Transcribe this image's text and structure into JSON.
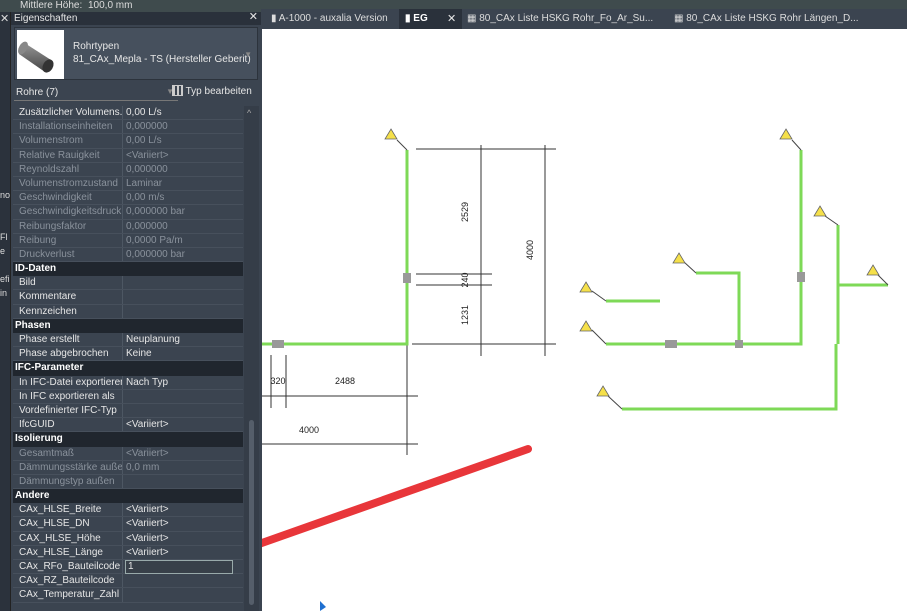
{
  "topbar": {
    "label": "Mittlere Höhe:",
    "value": "100,0 mm"
  },
  "leftstrip": [
    "no",
    "Fl",
    "e",
    "efi",
    "in"
  ],
  "panel": {
    "title": "Eigenschaften",
    "type_category": "Rohrtypen",
    "type_name": "81_CAx_Mepla - TS (Hersteller Geberit)",
    "filter": "Rohre (7)",
    "edit_type": "Typ bearbeiten"
  },
  "props": [
    {
      "k": "Zusätzlicher Volumens...",
      "v": "0,00 L/s"
    },
    {
      "k": "Installationseinheiten",
      "v": "0,000000",
      "dis": 1
    },
    {
      "k": "Volumenstrom",
      "v": "0,00 L/s",
      "dis": 1
    },
    {
      "k": "Relative Rauigkeit",
      "v": "<Variiert>",
      "dis": 1
    },
    {
      "k": "Reynoldszahl",
      "v": "0,000000",
      "dis": 1
    },
    {
      "k": "Volumenstromzustand",
      "v": "Laminar",
      "dis": 1
    },
    {
      "k": "Geschwindigkeit",
      "v": "0,00 m/s",
      "dis": 1
    },
    {
      "k": "Geschwindigkeitsdruck",
      "v": "0,000000 bar",
      "dis": 1
    },
    {
      "k": "Reibungsfaktor",
      "v": "0,000000",
      "dis": 1
    },
    {
      "k": "Reibung",
      "v": "0,0000 Pa/m",
      "dis": 1
    },
    {
      "k": "Druckverlust",
      "v": "0,000000 bar",
      "dis": 1
    },
    {
      "section": "ID-Daten"
    },
    {
      "k": "Bild",
      "v": ""
    },
    {
      "k": "Kommentare",
      "v": "",
      "cb": 1
    },
    {
      "k": "Kennzeichen",
      "v": ""
    },
    {
      "section": "Phasen"
    },
    {
      "k": "Phase erstellt",
      "v": "Neuplanung"
    },
    {
      "k": "Phase abgebrochen",
      "v": "Keine"
    },
    {
      "section": "IFC-Parameter"
    },
    {
      "k": "In IFC-Datei exportieren",
      "v": "Nach Typ"
    },
    {
      "k": "In IFC exportieren als",
      "v": ""
    },
    {
      "k": "Vordefinierter IFC-Typ",
      "v": ""
    },
    {
      "k": "IfcGUID",
      "v": "<Variiert>"
    },
    {
      "section": "Isolierung"
    },
    {
      "k": "Gesamtmaß",
      "v": "<Variiert>",
      "dis": 1
    },
    {
      "k": "Dämmungsstärke außen",
      "v": "0,0 mm",
      "dis": 1
    },
    {
      "k": "Dämmungstyp außen",
      "v": "",
      "dis": 1
    },
    {
      "section": "Andere"
    },
    {
      "k": "CAx_HLSE_Breite",
      "v": "<Variiert>",
      "cb": 1
    },
    {
      "k": "CAx_HLSE_DN",
      "v": "<Variiert>",
      "cb": 1
    },
    {
      "k": "CAX_HLSE_Höhe",
      "v": "<Variiert>",
      "cb": 1
    },
    {
      "k": "CAx_HLSE_Länge",
      "v": "<Variiert>",
      "cb": 1
    },
    {
      "k": "CAx_RFo_Bauteilcode",
      "v": "1",
      "cb": 1,
      "edit": 1
    },
    {
      "k": "CAx_RZ_Bauteilcode",
      "v": "",
      "cb": 1
    },
    {
      "k": "CAx_Temperatur_Zahl",
      "v": "",
      "cb": 1
    }
  ],
  "tabs": [
    {
      "label": "A-1000 - auxalia Version"
    },
    {
      "label": "EG",
      "active": true
    },
    {
      "label": "80_CAx Liste HSKG Rohr_Fo_Ar_Su..."
    },
    {
      "label": "80_CAx Liste HSKG Rohr Längen_D..."
    }
  ],
  "dims": {
    "d1": "2529",
    "d2": "240",
    "d3": "1231",
    "d4": "4000",
    "d5": "320",
    "d6": "2488",
    "d7": "4000"
  },
  "colors": {
    "pipe": "#7ed957",
    "arrow": "#e8363a",
    "warning": "#f5e04a"
  }
}
